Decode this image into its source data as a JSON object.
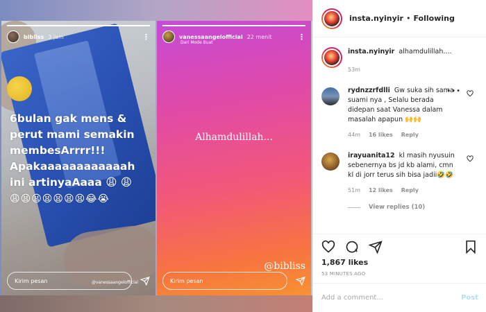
{
  "post": {
    "username": "insta.nyinyir",
    "follow_status": "Following",
    "caption": "alhamdulillah....",
    "caption_time": "53m",
    "likes": "1,867 likes",
    "posted_ago": "53 MINUTES AGO",
    "comment_placeholder": "Add a comment...",
    "post_label": "Post"
  },
  "comments": [
    {
      "username": "rydnzzrfdlli",
      "text": "Gw suka sih sama suami nya , Selalu berada didepan saat Vanessa dalam masalah apapun 🙌🙌",
      "time": "44m",
      "likes": "16 likes",
      "reply": "Reply"
    },
    {
      "username": "irayuanita12",
      "text": "kl masih nyusuin sebenernya bs jd kb alami, cmn kl di jorr terus sih bisa jadii🤣🤣",
      "time": "51m",
      "likes": "12 likes",
      "reply": "Reply"
    }
  ],
  "view_replies": "View replies (10)",
  "story_left": {
    "username": "bibliss",
    "time": "3 jam",
    "text": "6bulan gak mens & perut mami semakin membesArrrr!!! Apakaaaaaaaaaaaah ini artinyaAaaa 😩 😩",
    "emojis": "😩😫😫😫😫😫😫😂😭",
    "reply_placeholder": "Kirim pesan",
    "mention": "@vanessaangelofficial",
    "progress": 1.0
  },
  "story_right": {
    "username": "vanessaangelofficial",
    "time": "22 menit",
    "subtitle": "Dari Mode Buat",
    "text": "Alhamdulillah...",
    "mention": "@bibliss",
    "reply_placeholder": "Kirim pesan",
    "progress": 1.0
  }
}
